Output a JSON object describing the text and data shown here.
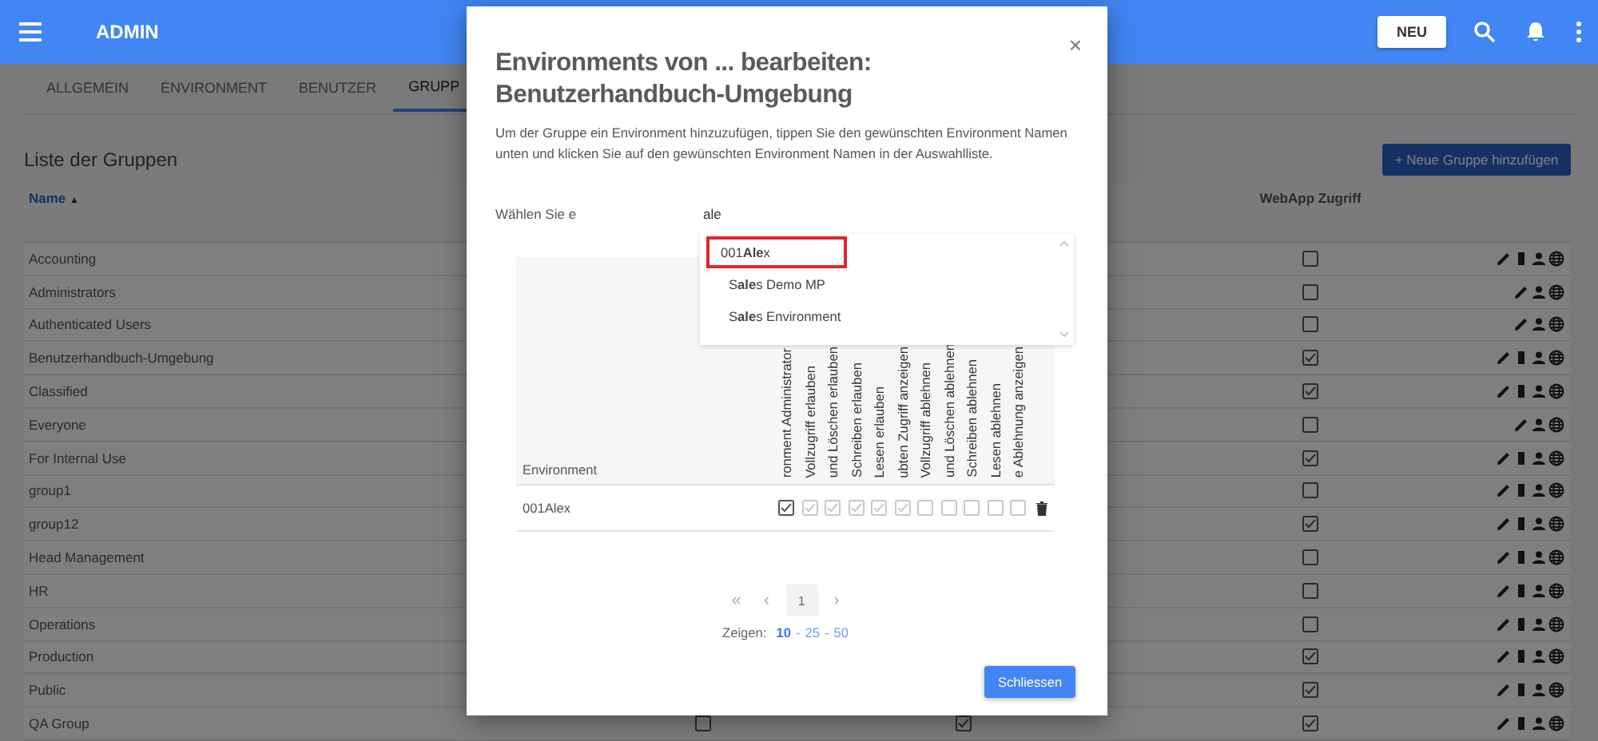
{
  "topbar": {
    "title": "ADMIN",
    "new_button": "NEU"
  },
  "tabs": [
    {
      "label": "ALLGEMEIN",
      "selected": false
    },
    {
      "label": "ENVIRONMENT",
      "selected": false
    },
    {
      "label": "BENUTZER",
      "selected": false
    },
    {
      "label": "GRUPP",
      "selected": true
    }
  ],
  "list_title": "Liste der Gruppen",
  "add_button": "+ Neue Gruppe hinzufügen",
  "columns": {
    "name": "Name",
    "sort": "▲",
    "webapp": "WebApp Zugriff"
  },
  "groups": [
    {
      "name": "Accounting",
      "webapp_access": false,
      "deletable": true
    },
    {
      "name": "Administrators",
      "webapp_access": false,
      "deletable": false
    },
    {
      "name": "Authenticated Users",
      "webapp_access": false,
      "deletable": false
    },
    {
      "name": "Benutzerhandbuch-Umgebung",
      "webapp_access": true,
      "deletable": true
    },
    {
      "name": "Classified",
      "webapp_access": true,
      "deletable": true
    },
    {
      "name": "Everyone",
      "webapp_access": false,
      "deletable": false
    },
    {
      "name": "For Internal Use",
      "webapp_access": true,
      "deletable": true
    },
    {
      "name": "group1",
      "webapp_access": false,
      "deletable": true
    },
    {
      "name": "group12",
      "webapp_access": true,
      "deletable": true
    },
    {
      "name": "Head Management",
      "webapp_access": false,
      "deletable": true
    },
    {
      "name": "HR",
      "webapp_access": false,
      "deletable": true
    },
    {
      "name": "Operations",
      "webapp_access": false,
      "deletable": true
    },
    {
      "name": "Production",
      "webapp_access": true,
      "deletable": true
    },
    {
      "name": "Public",
      "webapp_access": true,
      "deletable": true
    },
    {
      "name": "QA Group",
      "webapp_access": true,
      "deletable": true,
      "column_2": false,
      "column_3": true
    }
  ],
  "dialog": {
    "title": "Environments von ... bearbeiten: Benutzerhandbuch-Umgebung",
    "close": "×",
    "description": "Um der Gruppe ein Environment hinzuzufügen, tippen Sie den gewünschten Environment Namen unten und klicken Sie auf den gewünschten Environment Namen in der Auswahlliste.",
    "field_label": "Wählen Sie e",
    "field_value": "ale",
    "suggestions": [
      {
        "label": "001**Ale**x",
        "selected": true
      },
      {
        "label": "S**ale**s Demo MP",
        "selected": false
      },
      {
        "label": "S**ale**s Environment",
        "selected": false
      }
    ],
    "table": {
      "environment_header": "Environment",
      "permission_headers": [
        "ronment Administrator",
        "Vollzugriff erlauben",
        "und Löschen erlauben",
        "Schreiben erlauben",
        "Lesen erlauben",
        "ubten Zugriff anzeigen",
        "Vollzugriff ablehnen",
        "und Löschen ablehnen",
        "Schreiben ablehnen",
        "Lesen ablehnen",
        "e Ablehnung anzeigen"
      ],
      "rows": [
        {
          "name": "001Alex",
          "permissions": [
            {
              "checked": true,
              "disabled": false
            },
            {
              "checked": true,
              "disabled": true
            },
            {
              "checked": true,
              "disabled": true
            },
            {
              "checked": true,
              "disabled": true
            },
            {
              "checked": true,
              "disabled": true
            },
            {
              "checked": true,
              "disabled": true
            },
            {
              "checked": false,
              "disabled": true
            },
            {
              "checked": false,
              "disabled": true
            },
            {
              "checked": false,
              "disabled": true
            },
            {
              "checked": false,
              "disabled": true
            },
            {
              "checked": false,
              "disabled": true
            }
          ]
        }
      ]
    },
    "pagination": {
      "first": "«",
      "previous": "‹",
      "page": "1",
      "next": "›"
    },
    "page_size": {
      "label": "Zeigen:",
      "separator": "-",
      "sizes": [
        {
          "label": "10",
          "selected": true
        },
        {
          "label": "25",
          "selected": false
        },
        {
          "label": "50",
          "selected": false
        }
      ]
    },
    "close_button": "Schliessen"
  }
}
